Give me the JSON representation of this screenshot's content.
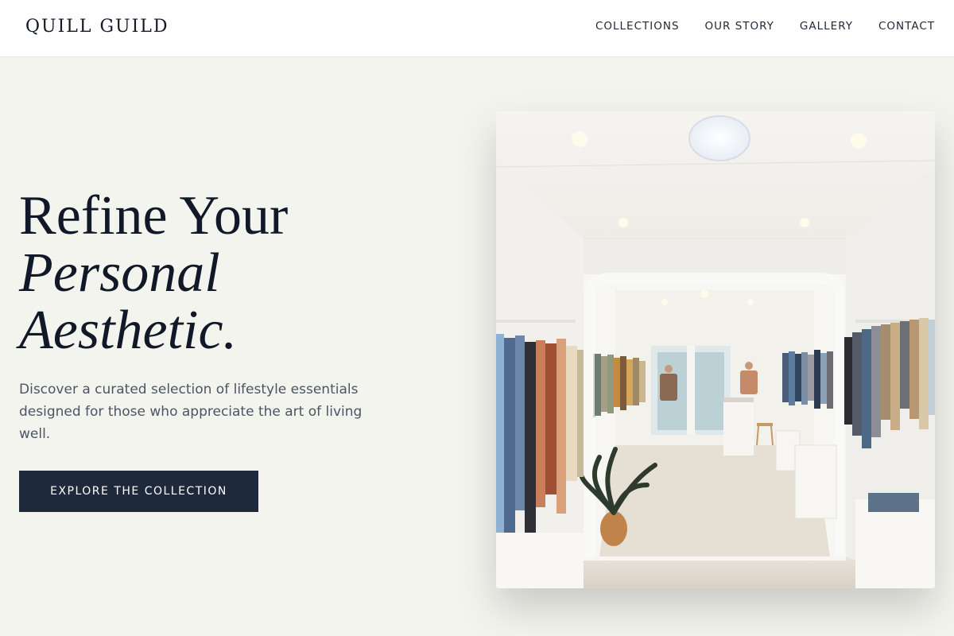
{
  "brand": {
    "name": "QUILL GUILD"
  },
  "nav": {
    "items": [
      {
        "label": "COLLECTIONS"
      },
      {
        "label": "OUR STORY"
      },
      {
        "label": "GALLERY"
      },
      {
        "label": "CONTACT"
      }
    ]
  },
  "hero": {
    "headline": {
      "line1": "Refine Your",
      "line2": "Personal",
      "line3": "Aesthetic."
    },
    "description": "Discover a curated selection of lifestyle essentials designed for those who appreciate the art of living well.",
    "cta_label": "EXPLORE THE COLLECTION"
  },
  "colors": {
    "background": "#f4f4ef",
    "navbar": "#fefefe",
    "headline": "#111827",
    "body_text": "#4b5563",
    "button": "#1e293b",
    "button_text": "#ffffff"
  }
}
